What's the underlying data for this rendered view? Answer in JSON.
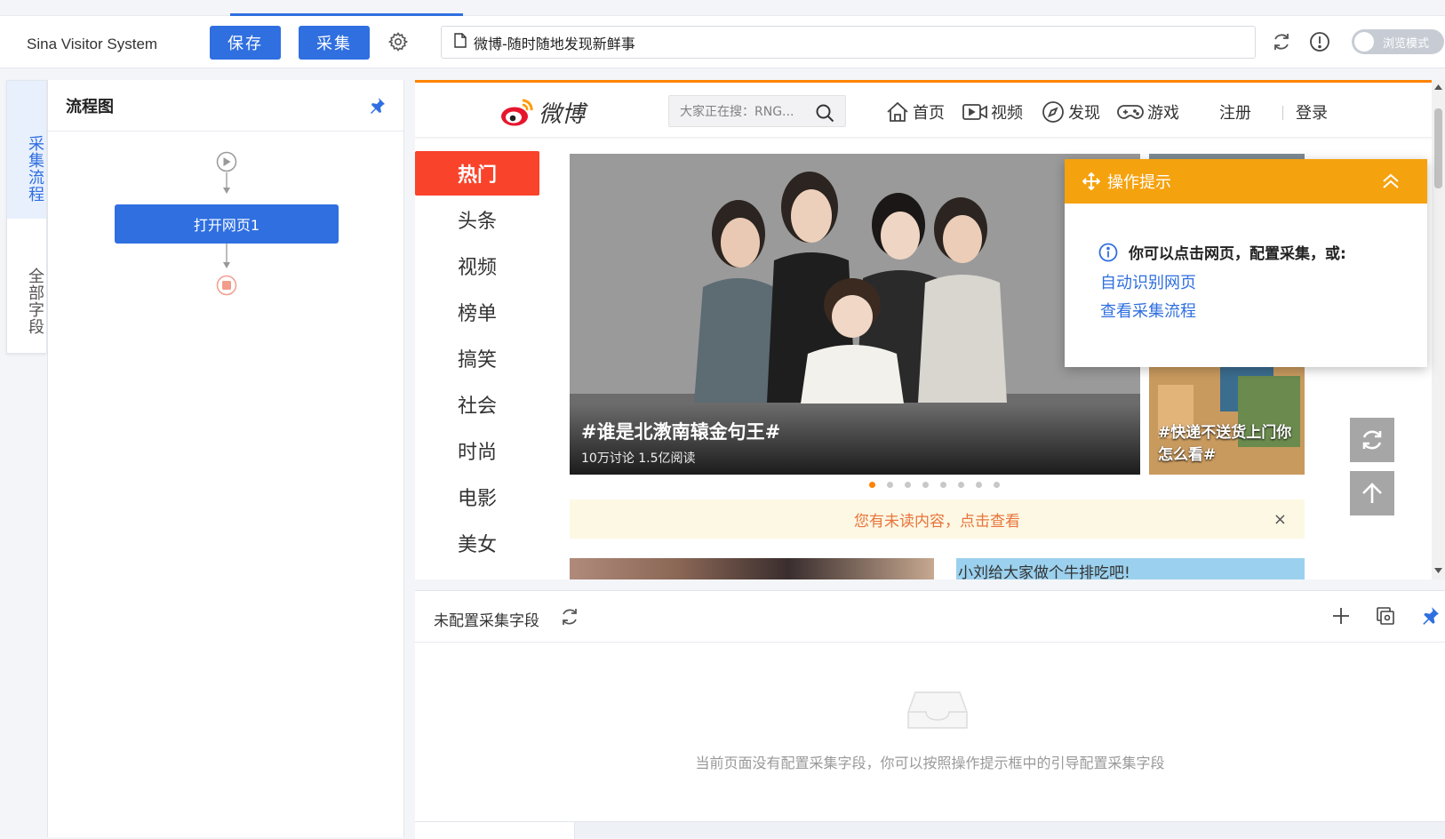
{
  "toolbar": {
    "app_title": "Sina Visitor System",
    "save_label": "保存",
    "collect_label": "采集",
    "url_text": "微博-随时随地发现新鲜事",
    "browse_mode_label": "浏览模式",
    "accent_color": "#2f6fe0"
  },
  "left_tabs": {
    "flow": "采集流程",
    "fields": "全部字段"
  },
  "flow_panel": {
    "title": "流程图",
    "node_label": "打开网页1"
  },
  "weibo": {
    "logo_text": "微博",
    "search_placeholder": "大家正在搜：RNG...",
    "nav": {
      "home": "首页",
      "video": "视频",
      "discover": "发现",
      "games": "游戏",
      "register": "注册",
      "login": "登录"
    },
    "categories": [
      "热门",
      "头条",
      "视频",
      "榜单",
      "搞笑",
      "社会",
      "时尚",
      "电影",
      "美女"
    ],
    "hero": {
      "title": "#谁是北漖南辕金句王#",
      "meta": "10万讨论    1.5亿阅读"
    },
    "hero2_caption": "#快递不送货上门你怎么看#",
    "unread_notice": "您有未读内容，点击查看",
    "unread_close": "×",
    "feed2_text": "小刘给大家做个牛排吃吧!",
    "brand_color": "#ff8200",
    "hot_color": "#f9432b"
  },
  "tip": {
    "title": "操作提示",
    "message": "你可以点击网页，配置采集，或:",
    "link_auto": "自动识别网页",
    "link_view": "查看采集流程",
    "color": "#f5a20f"
  },
  "fields_panel": {
    "title": "未配置采集字段",
    "empty_message": "当前页面没有配置采集字段，你可以按照操作提示框中的引导配置采集字段"
  }
}
